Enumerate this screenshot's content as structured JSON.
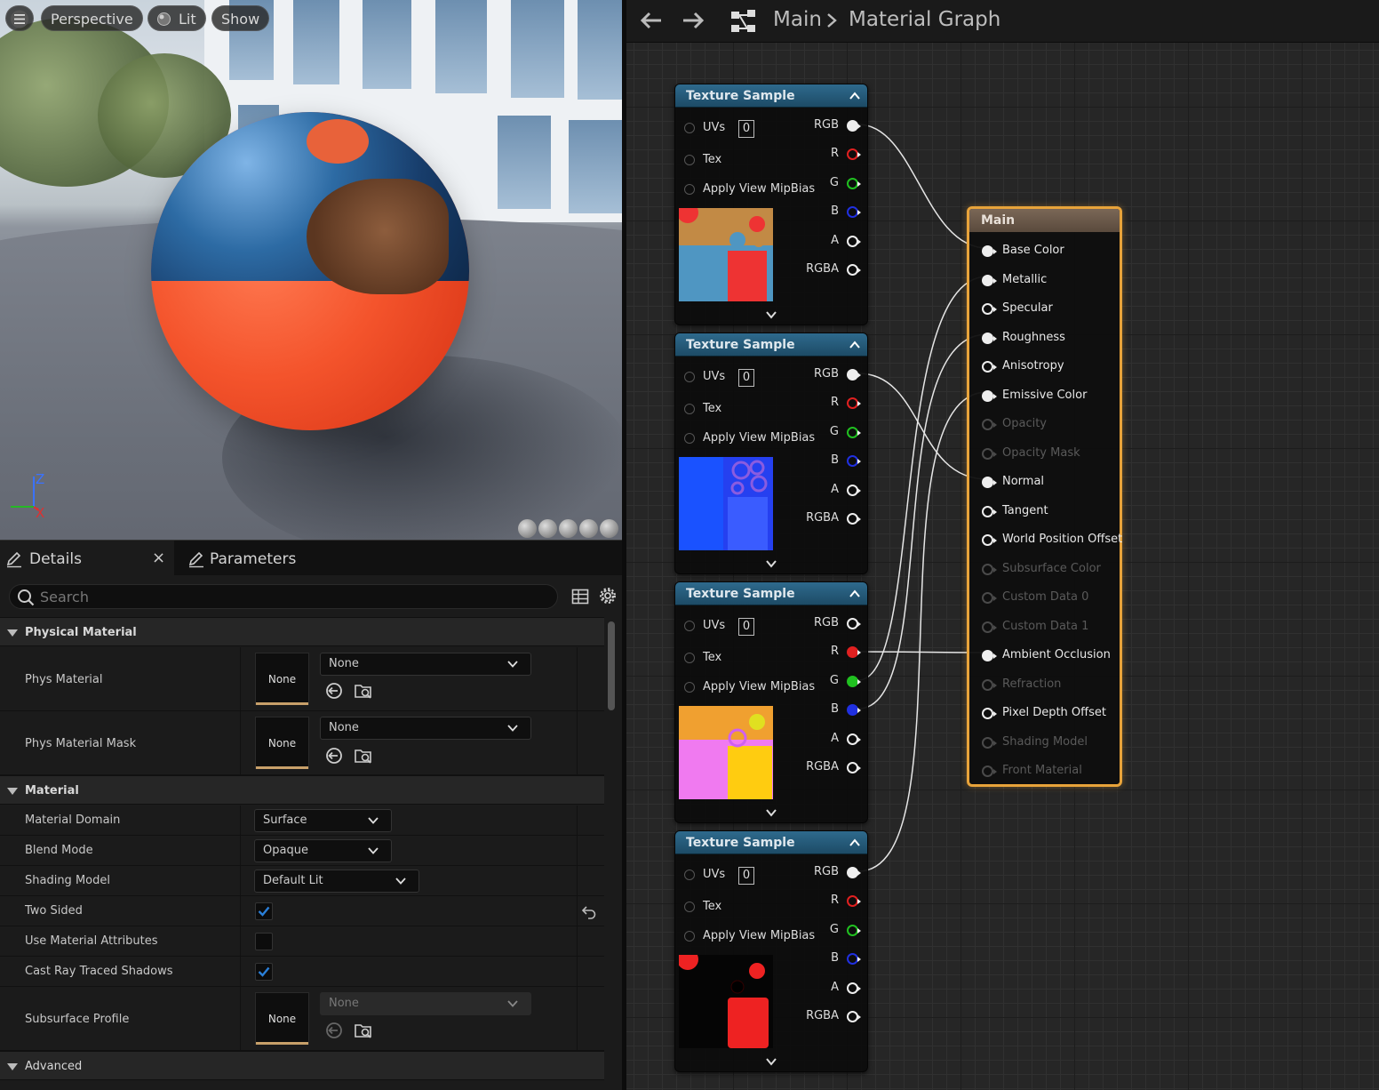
{
  "viewport": {
    "menu_icon": "hamburger-menu-icon",
    "perspective_label": "Perspective",
    "lit_label": "Lit",
    "show_label": "Show",
    "axis_z": "Z",
    "axis_x": "X"
  },
  "details": {
    "tabs": [
      {
        "label": "Details",
        "icon": "edit-icon"
      },
      {
        "label": "Parameters",
        "icon": "edit-icon"
      }
    ],
    "close_glyph": "×",
    "search_placeholder": "Search",
    "categories": {
      "physical_material": "Physical Material",
      "material": "Material",
      "advanced": "Advanced"
    },
    "properties": {
      "phys_material": {
        "label": "Phys Material",
        "thumb": "None",
        "value": "None"
      },
      "phys_material_mask": {
        "label": "Phys Material Mask",
        "thumb": "None",
        "value": "None"
      },
      "material_domain": {
        "label": "Material Domain",
        "value": "Surface"
      },
      "blend_mode": {
        "label": "Blend Mode",
        "value": "Opaque"
      },
      "shading_model": {
        "label": "Shading Model",
        "value": "Default Lit"
      },
      "two_sided": {
        "label": "Two Sided",
        "checked": true
      },
      "use_material_attributes": {
        "label": "Use Material Attributes",
        "checked": false
      },
      "cast_ray_traced_shadows": {
        "label": "Cast Ray Traced Shadows",
        "checked": true
      },
      "subsurface_profile": {
        "label": "Subsurface Profile",
        "thumb": "None",
        "value": "None"
      }
    }
  },
  "graph": {
    "breadcrumb": [
      "Main",
      "Material Graph"
    ],
    "texture_nodes": [
      {
        "title": "Texture Sample",
        "uv_index": "0",
        "preview": "base-color"
      },
      {
        "title": "Texture Sample",
        "uv_index": "0",
        "preview": "normal"
      },
      {
        "title": "Texture Sample",
        "uv_index": "0",
        "preview": "orm"
      },
      {
        "title": "Texture Sample",
        "uv_index": "0",
        "preview": "emissive"
      }
    ],
    "texture_inputs": [
      "UVs",
      "Tex",
      "Apply View MipBias"
    ],
    "texture_outputs": [
      "RGB",
      "R",
      "G",
      "B",
      "A",
      "RGBA"
    ],
    "main_node": {
      "title": "Main",
      "pins": [
        {
          "label": "Base Color",
          "connected": true,
          "enabled": true
        },
        {
          "label": "Metallic",
          "connected": true,
          "enabled": true
        },
        {
          "label": "Specular",
          "connected": false,
          "enabled": true
        },
        {
          "label": "Roughness",
          "connected": true,
          "enabled": true
        },
        {
          "label": "Anisotropy",
          "connected": false,
          "enabled": true
        },
        {
          "label": "Emissive Color",
          "connected": true,
          "enabled": true
        },
        {
          "label": "Opacity",
          "connected": false,
          "enabled": false
        },
        {
          "label": "Opacity Mask",
          "connected": false,
          "enabled": false
        },
        {
          "label": "Normal",
          "connected": true,
          "enabled": true
        },
        {
          "label": "Tangent",
          "connected": false,
          "enabled": true
        },
        {
          "label": "World Position Offset",
          "connected": false,
          "enabled": true
        },
        {
          "label": "Subsurface Color",
          "connected": false,
          "enabled": false
        },
        {
          "label": "Custom Data 0",
          "connected": false,
          "enabled": false
        },
        {
          "label": "Custom Data 1",
          "connected": false,
          "enabled": false
        },
        {
          "label": "Ambient Occlusion",
          "connected": true,
          "enabled": true
        },
        {
          "label": "Refraction",
          "connected": false,
          "enabled": false
        },
        {
          "label": "Pixel Depth Offset",
          "connected": false,
          "enabled": true
        },
        {
          "label": "Shading Model",
          "connected": false,
          "enabled": false
        },
        {
          "label": "Front Material",
          "connected": false,
          "enabled": false
        }
      ]
    }
  },
  "colors": {
    "accent": "#e8a33a",
    "node_header": "#2e6a8d",
    "pin_red": "#e02020",
    "pin_green": "#20c020",
    "pin_blue": "#2030e0",
    "checkbox": "#2a7fd8"
  }
}
